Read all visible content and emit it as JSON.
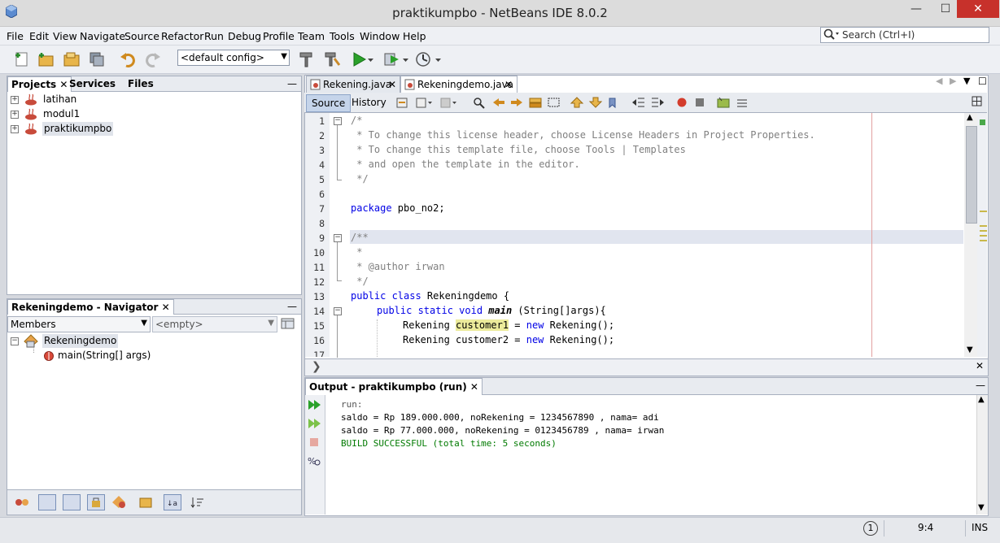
{
  "window": {
    "title": "praktikumpbo - NetBeans IDE 8.0.2",
    "minimize": "—",
    "maximize": "☐",
    "close": "✕"
  },
  "menu": [
    "File",
    "Edit",
    "View",
    "Navigate",
    "Source",
    "Refactor",
    "Run",
    "Debug",
    "Profile",
    "Team",
    "Tools",
    "Window",
    "Help"
  ],
  "search": {
    "placeholder": "Search (Ctrl+I)"
  },
  "toolbar": {
    "config": "<default config>"
  },
  "projects_panel": {
    "tabs": [
      "Projects",
      "Services",
      "Files"
    ],
    "minimize": "—",
    "items": [
      "latihan",
      "modul1",
      "praktikumpbo"
    ]
  },
  "navigator_panel": {
    "title": "Rekeningdemo - Navigator",
    "filter": "Members",
    "filter2": "<empty>",
    "tree": {
      "root": "Rekeningdemo",
      "child": "main(String[] args)"
    }
  },
  "editor": {
    "tabs": [
      "Rekening.java",
      "Rekeningdemo.java"
    ],
    "active_tab": "Rekeningdemo.java",
    "source_label": "Source",
    "history_label": "History",
    "line_numbers": [
      "1",
      "2",
      "3",
      "4",
      "5",
      "6",
      "7",
      "8",
      "9",
      "10",
      "11",
      "12",
      "13",
      "14",
      "15",
      "16",
      "17"
    ],
    "code": {
      "l1": "/*",
      "l2": " * To change this license header, choose License Headers in Project Properties.",
      "l3": " * To change this template file, choose Tools | Templates",
      "l4": " * and open the template in the editor.",
      "l5": " */",
      "l7_kw": "package",
      "l7_rest": " pbo_no2;",
      "l9": "/**",
      "l10": " *",
      "l11": " * @author irwan",
      "l12": " */",
      "l13_kw": "public class",
      "l13_rest": " Rekeningdemo {",
      "l14_kw": "public static void",
      "l14_name": "main",
      "l14_rest": " (String[]args){",
      "l15_a": "Rekening ",
      "l15_var": "customer1",
      "l15_b": " = ",
      "l15_kw": "new",
      "l15_c": " Rekening();",
      "l16_a": "Rekening customer2 = ",
      "l16_kw": "new",
      "l16_c": " Rekening();"
    }
  },
  "output": {
    "title": "Output - praktikumpbo (run)",
    "lines": [
      "run:",
      "saldo = Rp 189.000.000, noRekening = 1234567890 , nama= adi",
      "saldo = Rp 77.000.000, noRekening = 0123456789 , nama= irwan",
      "BUILD SUCCESSFUL (total time: 5 seconds)"
    ]
  },
  "status": {
    "notifications": "1",
    "position": "9:4",
    "mode": "INS"
  },
  "colors": {
    "accent": "#3a6ea5",
    "keyword": "#0000e6",
    "comment": "#808080",
    "success": "#007a00",
    "close": "#c7312b"
  }
}
